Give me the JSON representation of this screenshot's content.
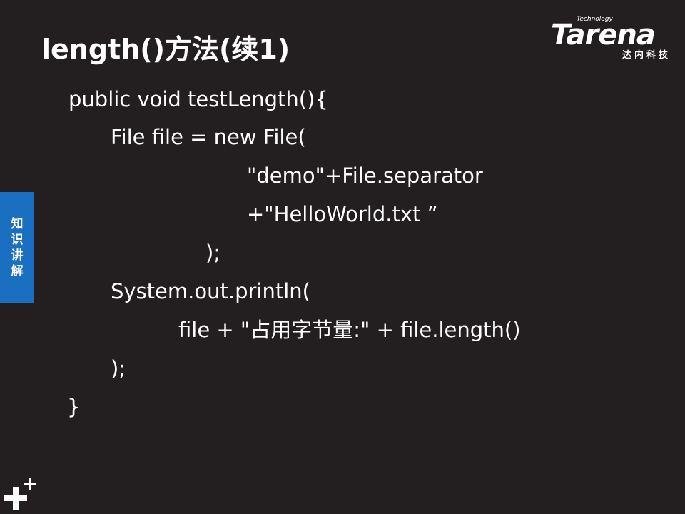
{
  "slide": {
    "title": "length()方法(续1)",
    "side_tab": [
      "知",
      "识",
      "讲",
      "解"
    ]
  },
  "logo": {
    "technology": "Technology",
    "brand": "Tarena",
    "chinese": "达内科技"
  },
  "code": {
    "lines": [
      "public void testLength(){",
      "File file = new File(",
      "\"demo\"+File.separator",
      "+\"HelloWorld.txt ”",
      ");",
      "System.out.println(",
      "file + \"占用字节量:\" + file.length()",
      ");",
      "}"
    ]
  },
  "colors": {
    "background": "#231f20",
    "text": "#ffffff",
    "side_tab": "#1a6fc0"
  }
}
